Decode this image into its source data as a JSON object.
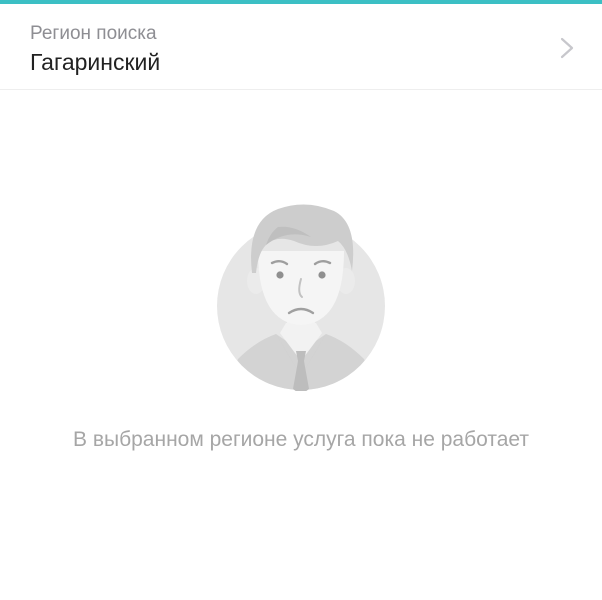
{
  "region": {
    "caption": "Регион поиска",
    "value": "Гагаринский"
  },
  "icons": {
    "chevron": "chevron-right-icon",
    "illustration": "sad-person-illustration"
  },
  "empty_state": {
    "message": "В выбранном регионе услуга пока не работает"
  },
  "colors": {
    "accent": "#3bbfc4",
    "caption": "#8e8e93",
    "value": "#222222",
    "message": "#a6a6a6",
    "illustration_circle": "#e6e6e6"
  }
}
